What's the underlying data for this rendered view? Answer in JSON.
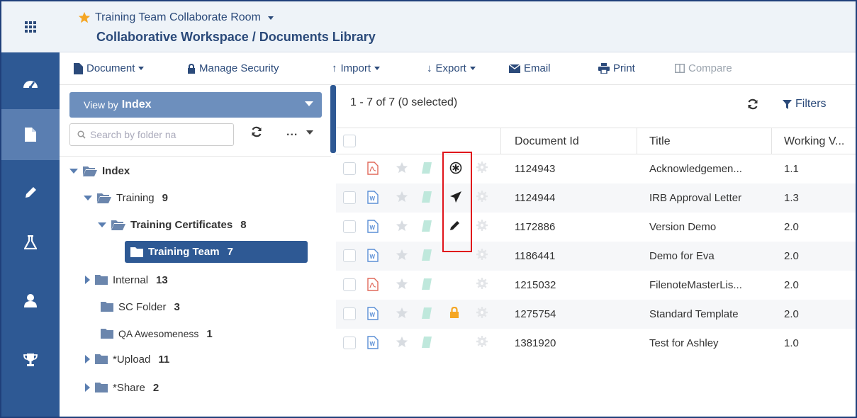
{
  "header": {
    "room_name": "Training Team Collaborate Room",
    "breadcrumb": "Collaborative Workspace / Documents Library"
  },
  "toolbar": {
    "document": "Document",
    "manage_security": "Manage Security",
    "import": "Import",
    "export": "Export",
    "email": "Email",
    "print": "Print",
    "compare": "Compare"
  },
  "nav": [
    "apps-icon",
    "dashboard-icon",
    "document-icon",
    "pencil-icon",
    "flask-icon",
    "user-icon",
    "trophy-icon"
  ],
  "folders": {
    "view_by_label": "View by",
    "view_by_value": "Index",
    "search_placeholder": "Search by folder na",
    "more_label": "...",
    "tree": [
      {
        "label": "Index",
        "count": ""
      },
      {
        "label": "Training",
        "count": "9"
      },
      {
        "label": "Training Certificates",
        "count": "8"
      },
      {
        "label": "Training Team",
        "count": "7"
      },
      {
        "label": "Internal",
        "count": "13"
      },
      {
        "label": "SC Folder",
        "count": "3"
      },
      {
        "label": "QA Awesomeness",
        "count": "1"
      },
      {
        "label": "*Upload",
        "count": "11"
      },
      {
        "label": "*Share",
        "count": "2"
      }
    ]
  },
  "grid": {
    "count_text": "1 - 7 of 7 (0 selected)",
    "filters_label": "Filters",
    "columns": [
      "Document Id",
      "Title",
      "Working V..."
    ],
    "rows": [
      {
        "file_type": "pdf",
        "status_icon": "asterisk-icon",
        "id": "1124943",
        "title": "Acknowledgemen...",
        "version": "1.1"
      },
      {
        "file_type": "word",
        "status_icon": "send-icon",
        "id": "1124944",
        "title": "IRB Approval Letter",
        "version": "1.3"
      },
      {
        "file_type": "word",
        "status_icon": "pencil-icon",
        "id": "1172886",
        "title": "Version Demo",
        "version": "2.0"
      },
      {
        "file_type": "word",
        "status_icon": "",
        "id": "1186441",
        "title": "Demo for Eva",
        "version": "2.0"
      },
      {
        "file_type": "pdf",
        "status_icon": "",
        "id": "1215032",
        "title": "FilenoteMasterLis...",
        "version": "2.0"
      },
      {
        "file_type": "word",
        "status_icon": "lock-icon",
        "id": "1275754",
        "title": "Standard Template",
        "version": "2.0"
      },
      {
        "file_type": "word",
        "status_icon": "",
        "id": "1381920",
        "title": "Test for Ashley",
        "version": "1.0"
      }
    ]
  },
  "colors": {
    "nav": "#2e5994",
    "nav_active": "#5a7eb1",
    "accent_text": "#2b4a7a",
    "highlight_box": "#e0141b",
    "star_header": "#f5a623"
  }
}
